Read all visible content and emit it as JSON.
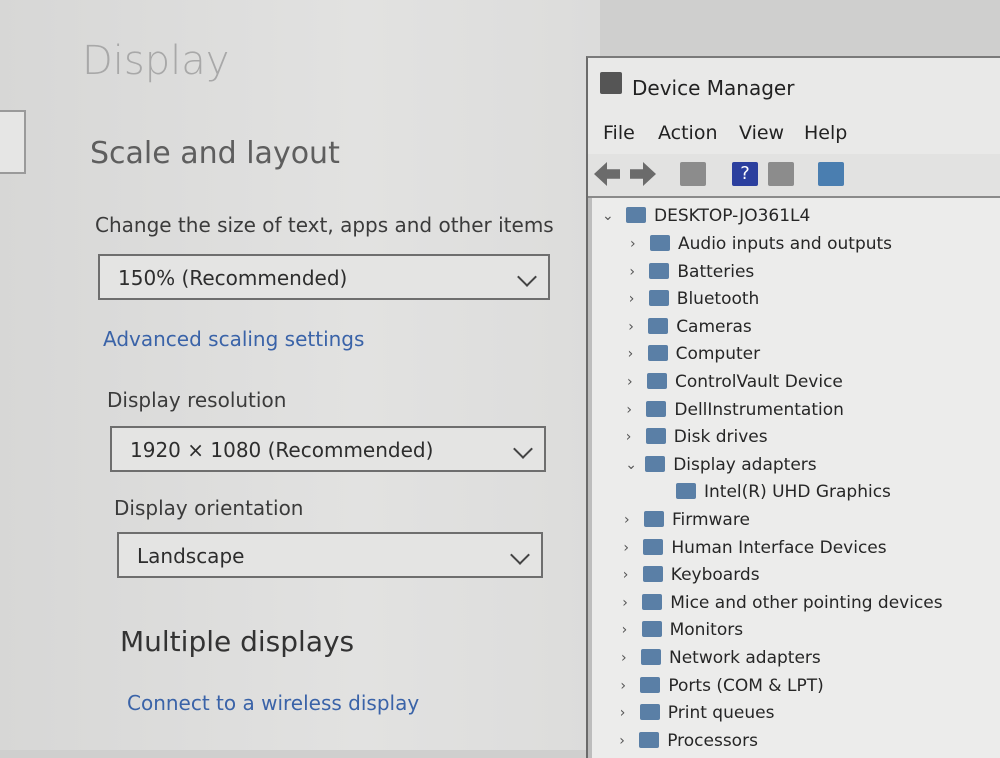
{
  "settings": {
    "page_title": "Display",
    "section_title": "Scale and layout",
    "scale_label": "Change the size of text, apps and other items",
    "scale_value": "150% (Recommended)",
    "advanced_link": "Advanced scaling settings",
    "resolution_label": "Display resolution",
    "resolution_value": "1920 × 1080 (Recommended)",
    "orientation_label": "Display orientation",
    "orientation_value": "Landscape",
    "multiple_title": "Multiple displays",
    "wireless_link": "Connect to a wireless display"
  },
  "device_manager": {
    "title": "Device Manager",
    "menu": [
      "File",
      "Action",
      "View",
      "Help"
    ],
    "root": "DESKTOP-JO361L4",
    "nodes": [
      "Audio inputs and outputs",
      "Batteries",
      "Bluetooth",
      "Cameras",
      "Computer",
      "ControlVault Device",
      "DellInstrumentation",
      "Disk drives",
      "Display adapters",
      "Intel(R) UHD Graphics",
      "Firmware",
      "Human Interface Devices",
      "Keyboards",
      "Mice and other pointing devices",
      "Monitors",
      "Network adapters",
      "Ports (COM & LPT)",
      "Print queues",
      "Processors"
    ]
  },
  "icons": {
    "back": "arrow-left-icon",
    "forward": "arrow-right-icon",
    "properties": "properties-icon",
    "help": "help-icon",
    "update": "update-driver-icon",
    "monitor": "monitor-icon"
  },
  "colors": {
    "link": "#3a63a8",
    "tree_icon": "#5a7fa6",
    "help_icon": "#2b3f9e"
  }
}
